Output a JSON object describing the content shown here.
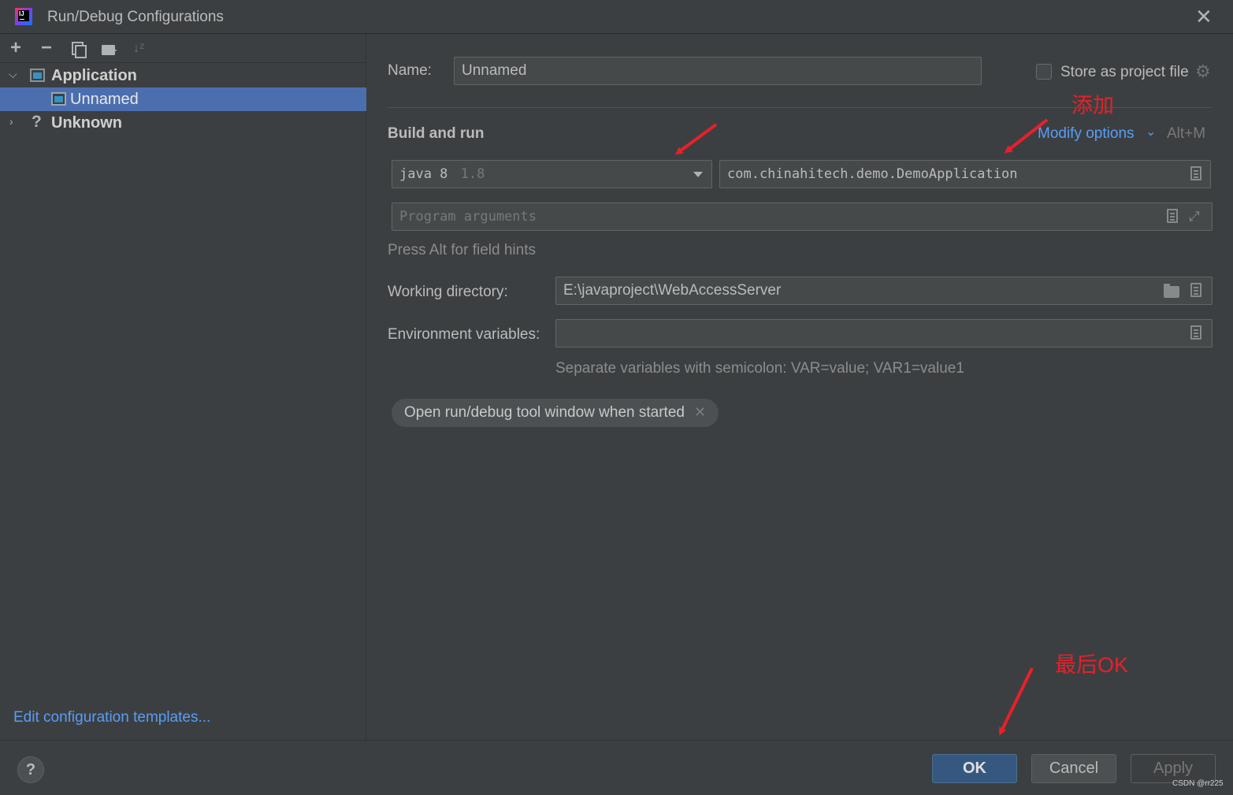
{
  "window": {
    "title": "Run/Debug Configurations",
    "close_icon": "close-icon"
  },
  "toolbar": {
    "add_icon": "plus-icon",
    "remove_icon": "minus-icon",
    "copy_icon": "copy-icon",
    "new_folder_icon": "new-folder-icon",
    "sort_icon": "sort-icon"
  },
  "tree": {
    "items": [
      {
        "label": "Application",
        "expanded": true
      },
      {
        "label": "Unnamed",
        "selected": true
      },
      {
        "label": "Unknown",
        "expanded": false
      }
    ]
  },
  "left_footer": {
    "edit_templates": "Edit configuration templates..."
  },
  "form": {
    "name_label": "Name:",
    "name_value": "Unnamed",
    "store_as_project_file": "Store as project file",
    "store_checked": false,
    "build_and_run": "Build and run",
    "modify_options": "Modify options",
    "modify_shortcut": "Alt+M",
    "jdk_name": "java 8",
    "jdk_version": "1.8",
    "main_class": "com.chinahitech.demo.DemoApplication",
    "program_args_placeholder": "Program arguments",
    "field_hints": "Press Alt for field hints",
    "working_dir_label": "Working directory:",
    "working_dir_value": "E:\\javaproject\\WebAccessServer",
    "env_vars_label": "Environment variables:",
    "env_vars_value": "",
    "env_vars_hint": "Separate variables with semicolon: VAR=value; VAR1=value1",
    "chip_label": "Open run/debug tool window when started"
  },
  "buttons": {
    "help": "?",
    "ok": "OK",
    "cancel": "Cancel",
    "apply": "Apply"
  },
  "annotations": {
    "add": "添加",
    "finally_ok": "最后OK",
    "color": "#e8202a"
  },
  "watermark": "CSDN @rr225",
  "colors": {
    "background": "#3c3f41",
    "selection": "#4b6eaf",
    "link": "#589df6",
    "ok_button": "#365880"
  }
}
